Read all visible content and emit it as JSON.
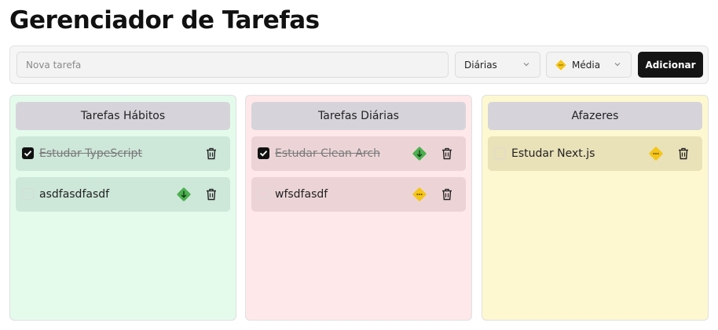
{
  "page": {
    "title": "Gerenciador de Tarefas"
  },
  "toolbar": {
    "input_placeholder": "Nova tarefa",
    "type_value": "Diárias",
    "priority_value": "Média",
    "add_label": "Adicionar"
  },
  "colors": {
    "low_priority": "#4caf50",
    "medium_priority": "#f5c518",
    "button": "#141414"
  },
  "columns": [
    {
      "title": "Tarefas Hábitos",
      "tasks": [
        {
          "label": "Estudar TypeScript",
          "done": true,
          "priority": null
        },
        {
          "label": "asdfasdfasdf",
          "done": false,
          "priority": "low-priority-icon"
        }
      ]
    },
    {
      "title": "Tarefas Diárias",
      "tasks": [
        {
          "label": "Estudar Clean Arch",
          "done": true,
          "priority": "low-priority-icon"
        },
        {
          "label": "wfsdfasdf",
          "done": false,
          "priority": "medium-priority-icon"
        }
      ]
    },
    {
      "title": "Afazeres",
      "tasks": [
        {
          "label": "Estudar Next.js",
          "done": false,
          "priority": "medium-priority-icon"
        }
      ]
    }
  ]
}
